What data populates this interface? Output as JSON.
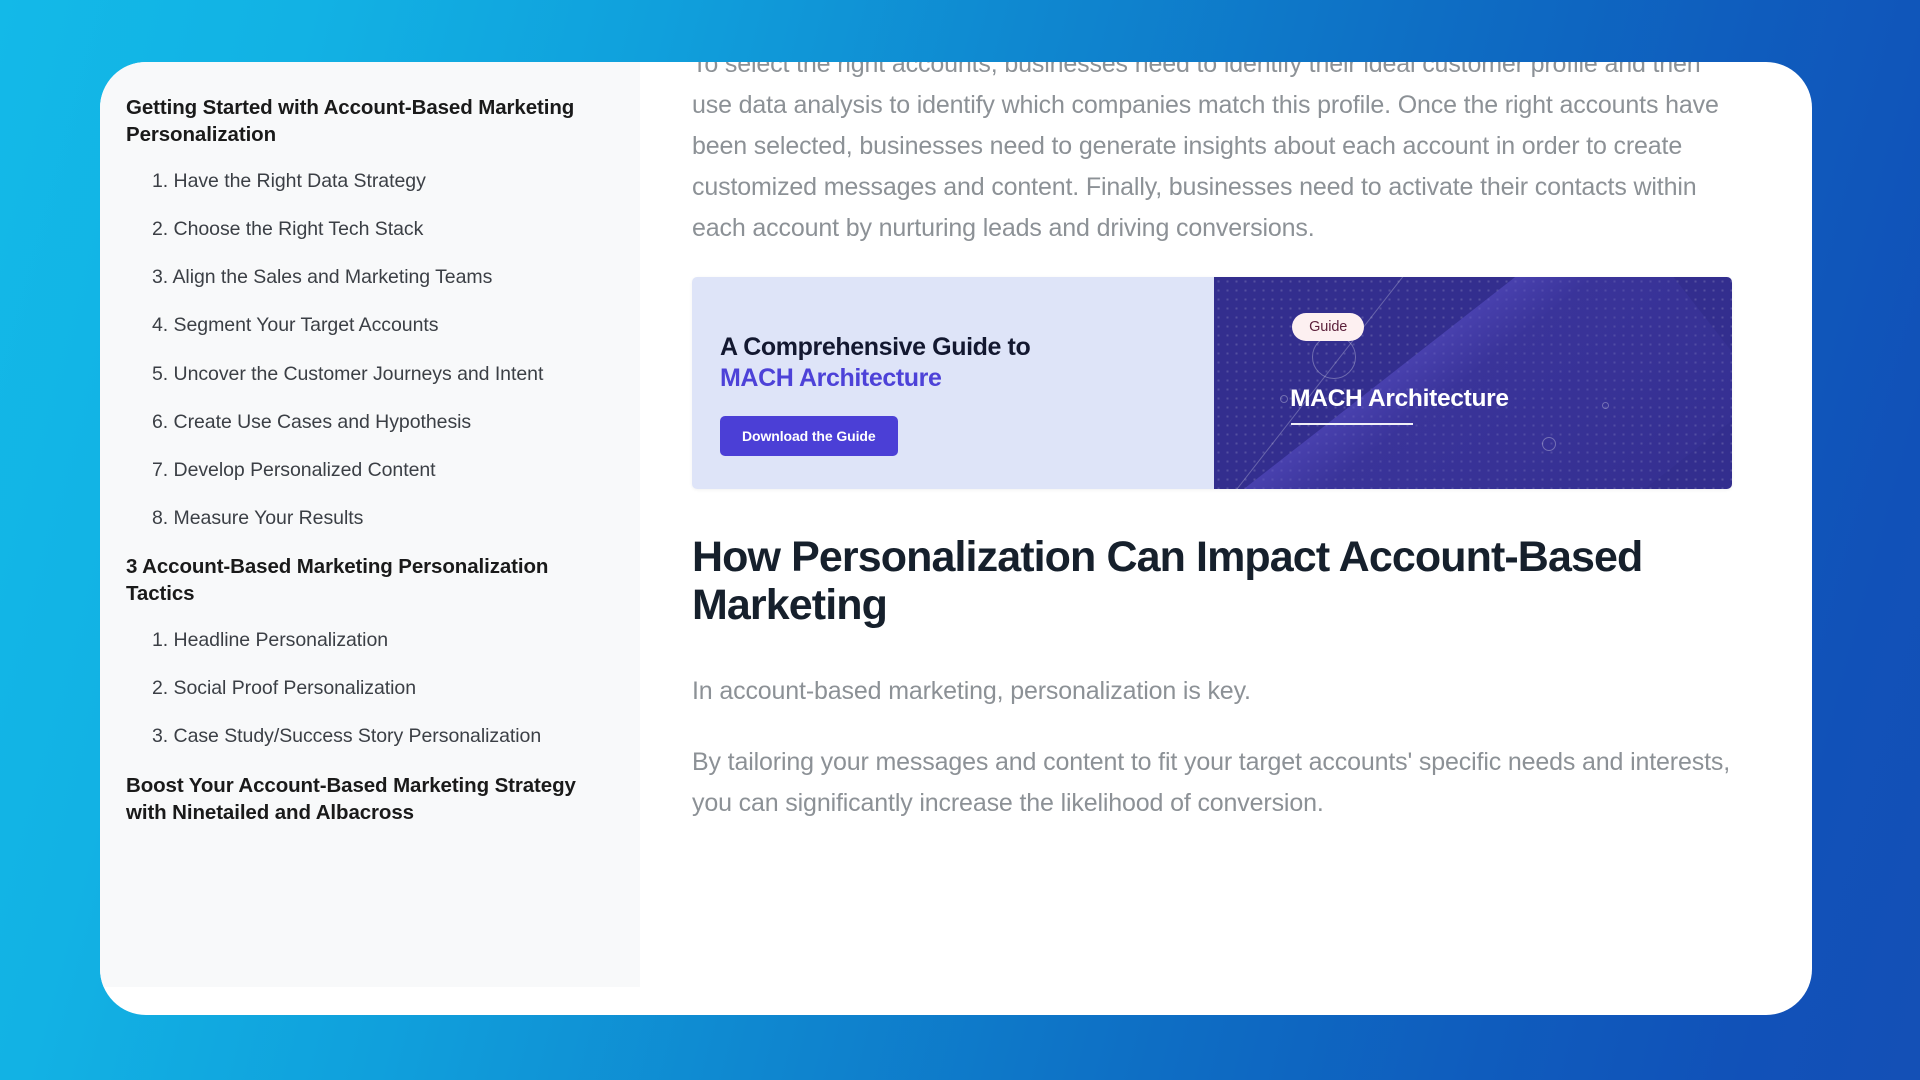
{
  "background": {
    "gradient_from": "#13b9e8",
    "gradient_to": "#1450b6"
  },
  "sidebar": {
    "section1": {
      "heading": "Getting Started with Account-Based Marketing Personalization",
      "items": [
        "1. Have the Right Data Strategy",
        "2. Choose the Right Tech Stack",
        "3. Align the Sales and Marketing Teams",
        "4. Segment Your Target Accounts",
        "5. Uncover the Customer Journeys and Intent",
        "6. Create Use Cases and Hypothesis",
        "7. Develop Personalized Content",
        "8. Measure Your Results"
      ]
    },
    "section2": {
      "heading": "3 Account-Based Marketing Personalization Tactics",
      "items": [
        "1. Headline Personalization",
        "2. Social Proof Personalization",
        "3. Case Study/Success Story Personalization"
      ]
    },
    "section3": {
      "heading": "Boost Your Account-Based Marketing Strategy with Ninetailed and Albacross"
    }
  },
  "content": {
    "paragraph_top": "To select the right accounts, businesses need to identify their ideal customer profile and then use data analysis to identify which companies match this profile. Once the right accounts have been selected, businesses need to generate insights about each account in order to create customized messages and content. Finally, businesses need to activate their contacts within each account by nurturing leads and driving conversions.",
    "banner": {
      "title_line1": "A Comprehensive Guide to",
      "title_line2": "MACH Architecture",
      "cta_label": "Download the Guide",
      "badge": "Guide",
      "panel_title": "MACH Architecture",
      "colors": {
        "left_bg": "#dee4f8",
        "right_bg": "#332e8e",
        "accent_text": "#4d42d8",
        "cta_bg": "#4b3fd6",
        "badge_bg": "#fdf0f1",
        "badge_text": "#5b1f3a"
      }
    },
    "section_heading": "How Personalization Can Impact Account-Based Marketing",
    "paragraph_1": "In account-based marketing, personalization is key.",
    "paragraph_2": "By tailoring your messages and content to fit your target accounts' specific needs and interests, you can significantly increase the likelihood of conversion."
  }
}
